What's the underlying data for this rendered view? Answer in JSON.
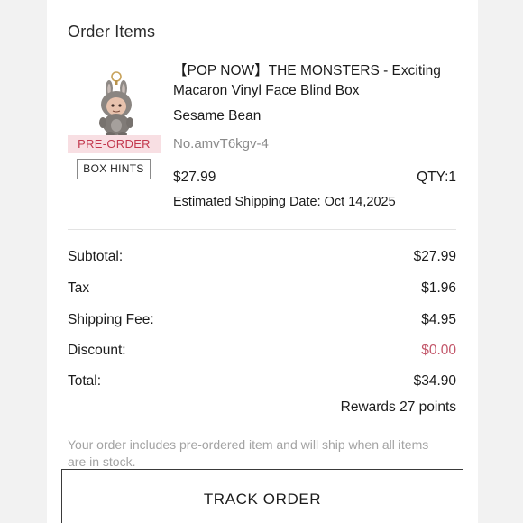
{
  "order_items": {
    "title": "Order Items",
    "item": {
      "badge": "PRE-ORDER",
      "box_hints_label": "BOX HINTS",
      "name": "【POP NOW】THE MONSTERS - Exciting Macaron Vinyl Face Blind Box",
      "variant": "Sesame Bean",
      "number": "No.amvT6kgv-4",
      "price": "$27.99",
      "qty": "QTY:1",
      "shipping_date": "Estimated Shipping Date: Oct 14,2025",
      "image_icon": "plush-keychain-figure"
    }
  },
  "summary": {
    "subtotal_label": "Subtotal:",
    "subtotal": "$27.99",
    "tax_label": "Tax",
    "tax": "$1.96",
    "shipping_label": "Shipping Fee:",
    "shipping": "$4.95",
    "discount_label": "Discount:",
    "discount": "$0.00",
    "total_label": "Total:",
    "total": "$34.90",
    "rewards": "Rewards 27 points"
  },
  "note": "Your order includes pre-ordered item and will ship when all items are in stock.",
  "track_button": "TRACK ORDER",
  "colors": {
    "badge_bg": "#f8dfe3",
    "badge_text": "#c3384e",
    "discount": "#c3576a",
    "note": "#a3a3a3"
  }
}
